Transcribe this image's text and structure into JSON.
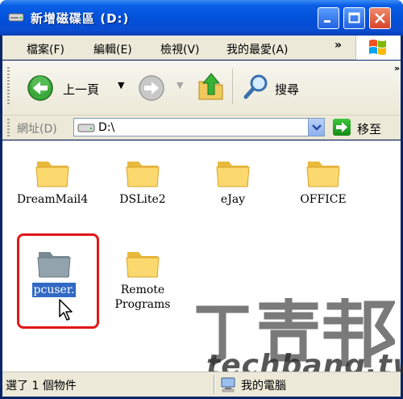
{
  "window": {
    "title": "新增磁碟區 (D:)"
  },
  "menu": {
    "items": [
      "檔案(F)",
      "編輯(E)",
      "檢視(V)",
      "我的最愛(A)"
    ],
    "more": "»"
  },
  "toolbar": {
    "back_label": "上一頁",
    "search_label": "搜尋",
    "more": "»"
  },
  "address": {
    "label": "網址(D)",
    "path": "D:\\",
    "go_label": "移至"
  },
  "folders": [
    {
      "name": "DreamMail4"
    },
    {
      "name": "DSLite2"
    },
    {
      "name": "eJay"
    },
    {
      "name": "OFFICE"
    },
    {
      "name": "pcuser."
    },
    {
      "name": "Remote\nPrograms"
    }
  ],
  "watermark": {
    "text": "techbang.tw"
  },
  "status": {
    "selection": "選了 1 個物件",
    "location": "我的電腦"
  }
}
